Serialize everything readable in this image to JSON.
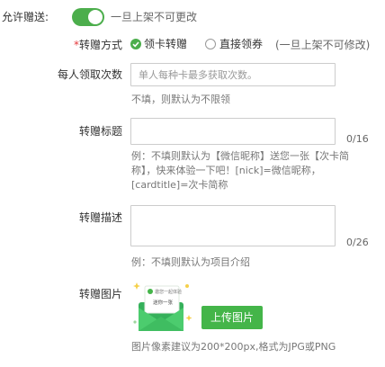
{
  "gift": {
    "label": "允许赠送:",
    "toggle_on": true,
    "note": "一旦上架不可更改"
  },
  "method": {
    "label": "*转赠方式",
    "options": [
      {
        "label": "领卡转赠",
        "checked": true
      },
      {
        "label": "直接领券",
        "checked": false
      }
    ],
    "note": "(一旦上架不可修改)"
  },
  "per_person": {
    "label": "每人领取次数",
    "placeholder": "单人每种卡最多获取次数。",
    "hint": "不填，则默认为不限领"
  },
  "title": {
    "label": "转赠标题",
    "counter": "0/16",
    "hint_lines": [
      "例：不填则默认为【微信昵称】送您一张【次卡简",
      "称】，快来体验一下吧！[nick]=微信昵称，",
      "[cardtitle]=次卡简称"
    ]
  },
  "description": {
    "label": "转赠描述",
    "counter": "0/26",
    "hint": "例：不填则默认为项目介绍"
  },
  "image": {
    "label": "转赠图片",
    "upload_button": "上传图片",
    "hint": "图片像素建议为200*200px,格式为JPG或PNG",
    "envelope_text": "邀您一起体验",
    "envelope_card": "送你一张"
  },
  "colors": {
    "accent_green": "#44b549",
    "toggle_green": "#4cae4c"
  }
}
